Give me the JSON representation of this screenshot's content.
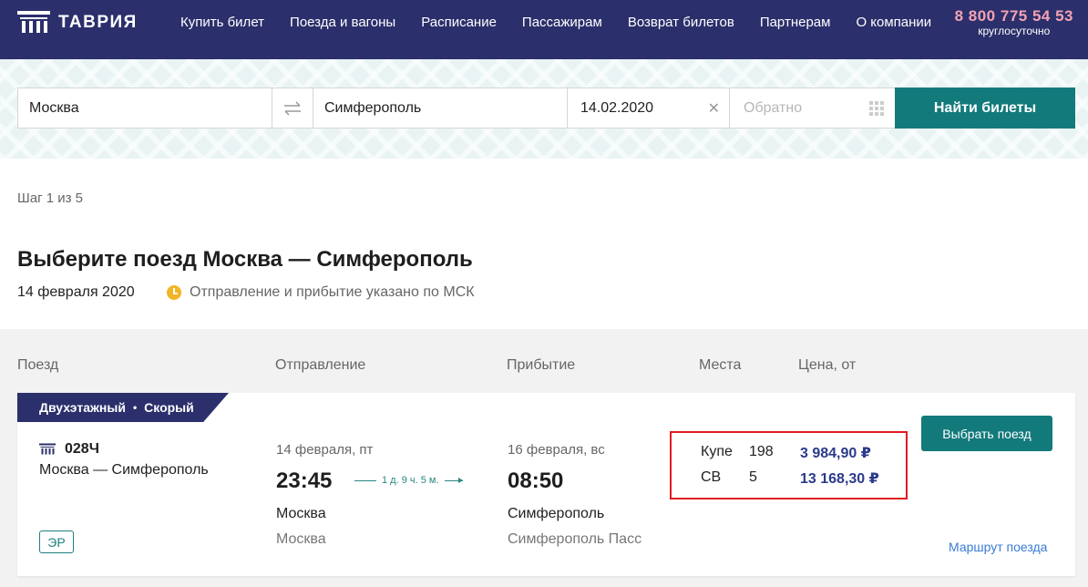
{
  "header": {
    "logo_text": "ТАВРИЯ",
    "nav": [
      "Купить билет",
      "Поезда и вагоны",
      "Расписание",
      "Пассажирам",
      "Возврат билетов",
      "Партнерам",
      "О компании"
    ],
    "phone": "8 800 775 54 53",
    "phone_note": "круглосуточно"
  },
  "search": {
    "from": "Москва",
    "to": "Симферополь",
    "date": "14.02.2020",
    "return_placeholder": "Обратно",
    "submit_label": "Найти билеты"
  },
  "step": "Шаг 1 из 5",
  "title": "Выберите поезд Москва — Симферополь",
  "date_text": "14 февраля 2020",
  "tz_note": "Отправление и прибытие указано по МСК",
  "columns": [
    "Поезд",
    "Отправление",
    "Прибытие",
    "Места",
    "Цена, от"
  ],
  "train": {
    "tags": [
      "Двухэтажный",
      "Скорый"
    ],
    "number": "028Ч",
    "route": "Москва — Симферополь",
    "er_badge": "ЭР",
    "departure": {
      "date": "14 февраля, пт",
      "time": "23:45",
      "city": "Москва",
      "station": "Москва"
    },
    "duration": "1 д. 9 ч. 5 м.",
    "arrival": {
      "date": "16 февраля, вс",
      "time": "08:50",
      "city": "Симферополь",
      "station": "Симферополь Пасс"
    },
    "seats": [
      {
        "class": "Купе",
        "count": "198",
        "price": "3 984,90 ₽"
      },
      {
        "class": "СВ",
        "count": "5",
        "price": "13 168,30 ₽"
      }
    ],
    "select_label": "Выбрать поезд",
    "route_link": "Маршрут поезда"
  }
}
